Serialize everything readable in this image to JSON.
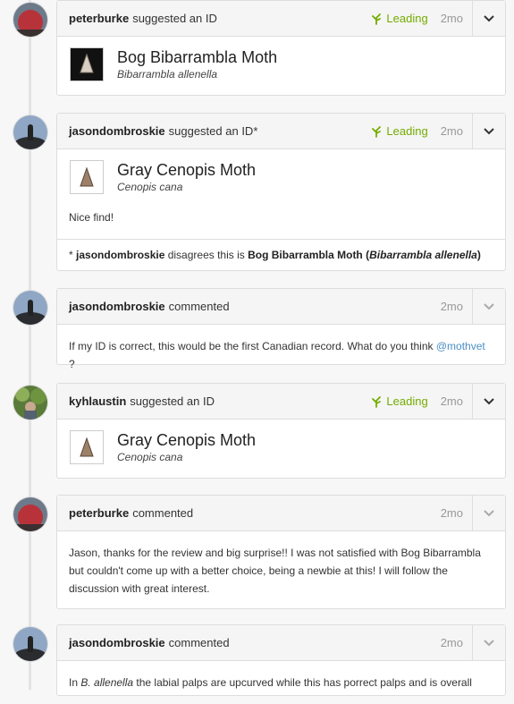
{
  "entries": [
    {
      "user": "peterburke",
      "action": "suggested an ID",
      "leading": "Leading",
      "time": "2mo",
      "taxon": {
        "common": "Bog Bibarrambla Moth",
        "scientific": "Bibarrambla allenella"
      }
    },
    {
      "user": "jasondombroskie",
      "action": "suggested an ID*",
      "leading": "Leading",
      "time": "2mo",
      "taxon": {
        "common": "Gray Cenopis Moth",
        "scientific": "Cenopis cana"
      },
      "body": "Nice find!",
      "disagree": {
        "prefix": "* ",
        "user": "jasondombroskie",
        "text": " disagrees this is ",
        "taxon_common": "Bog Bibarrambla Moth",
        "open": " (",
        "taxon_sci": "Bibarrambla allenella",
        "close": ")"
      }
    },
    {
      "user": "jasondombroskie",
      "action": "commented",
      "time": "2mo",
      "body_pre": "If my ID is correct, this would be the first Canadian record. What do you think ",
      "mention": "@mothvet",
      "body_post": " ?"
    },
    {
      "user": "kyhlaustin",
      "action": "suggested an ID",
      "leading": "Leading",
      "time": "2mo",
      "taxon": {
        "common": "Gray Cenopis Moth",
        "scientific": "Cenopis cana"
      }
    },
    {
      "user": "peterburke",
      "action": "commented",
      "time": "2mo",
      "body": "Jason, thanks for the review and big surprise!! I was not satisfied with Bog Bibarrambla but couldn't come up with a better choice, being a newbie at this! I will follow the discussion with great interest."
    },
    {
      "user": "jasondombroskie",
      "action": "commented",
      "time": "2mo",
      "body_pre": "In ",
      "body_em": "B. allenella",
      "body_post": " the labial palps are upcurved while this has porrect palps and is overall"
    }
  ],
  "colors": {
    "leading": "#74ac00",
    "mention": "#4a8fc5"
  },
  "icons": {
    "leading": "leading-sprout-icon",
    "menu": "chevron-down-icon"
  }
}
